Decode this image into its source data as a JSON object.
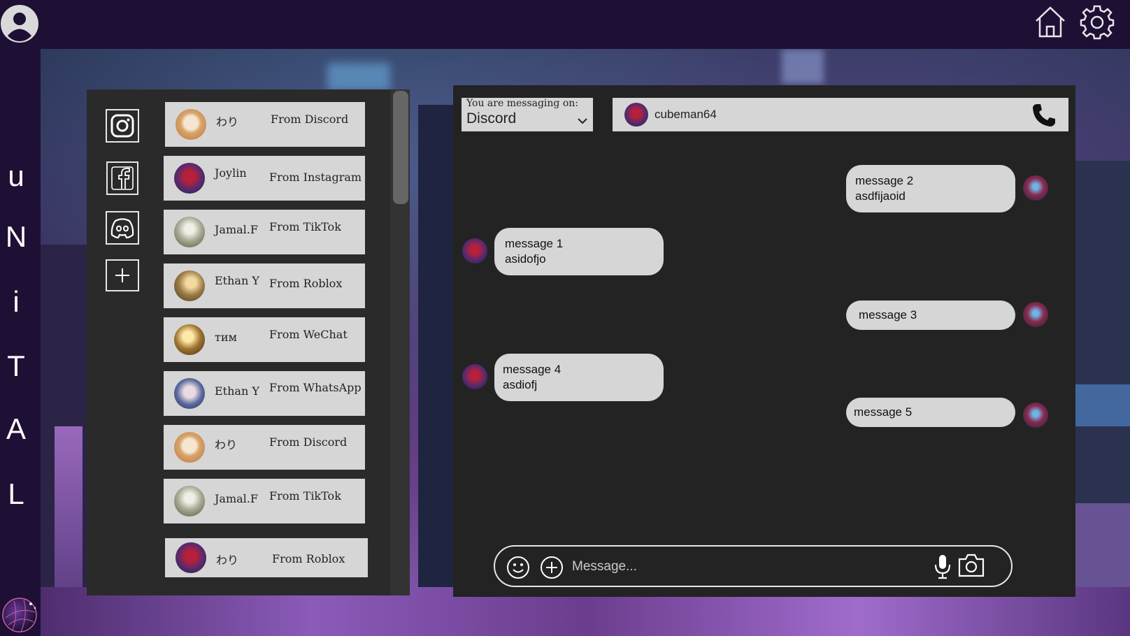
{
  "brand": {
    "letters": [
      "u",
      "N",
      "i",
      "T",
      "A",
      "L"
    ]
  },
  "icons": {
    "topbar": [
      "profile-icon",
      "home-icon",
      "gear-icon"
    ],
    "platforms": [
      "instagram-icon",
      "facebook-icon",
      "discord-icon",
      "plus-icon"
    ],
    "composer": [
      "emoji-icon",
      "add-attachment-icon",
      "microphone-icon",
      "camera-icon"
    ],
    "recipient": "phone-icon"
  },
  "contacts": [
    {
      "name": "わり",
      "source": "From Discord"
    },
    {
      "name": "Joylin",
      "source": "From Instagram"
    },
    {
      "name": "Jamal.F",
      "source": "From TikTok"
    },
    {
      "name": "Ethan Y",
      "source": "From Roblox"
    },
    {
      "name": "тим",
      "source": "From WeChat"
    },
    {
      "name": "Ethan Y",
      "source": "From WhatsApp"
    },
    {
      "name": "わり",
      "source": "From Discord"
    },
    {
      "name": "Jamal.F",
      "source": "From TikTok"
    },
    {
      "name": "わり",
      "source": "From Roblox"
    }
  ],
  "chat": {
    "platform_caption": "You are messaging on:",
    "platform_value": "Discord",
    "recipient_name": "cubeman64",
    "messages": [
      {
        "side": "sent",
        "line1": "message 2",
        "line2": "asdfijaoid"
      },
      {
        "side": "received",
        "line1": "message 1",
        "line2": "asidofjo"
      },
      {
        "side": "sent",
        "line1": "message 3",
        "line2": ""
      },
      {
        "side": "received",
        "line1": "message 4",
        "line2": "asdiofj"
      },
      {
        "side": "sent",
        "line1": "message 5",
        "line2": ""
      }
    ],
    "composer_placeholder": "Message..."
  },
  "colors": {
    "topbar": "#1e0f34",
    "panel": "#2a2a2a",
    "chat_panel": "#232323",
    "card": "#d6d6d6",
    "outline": "#e6e6e6"
  }
}
